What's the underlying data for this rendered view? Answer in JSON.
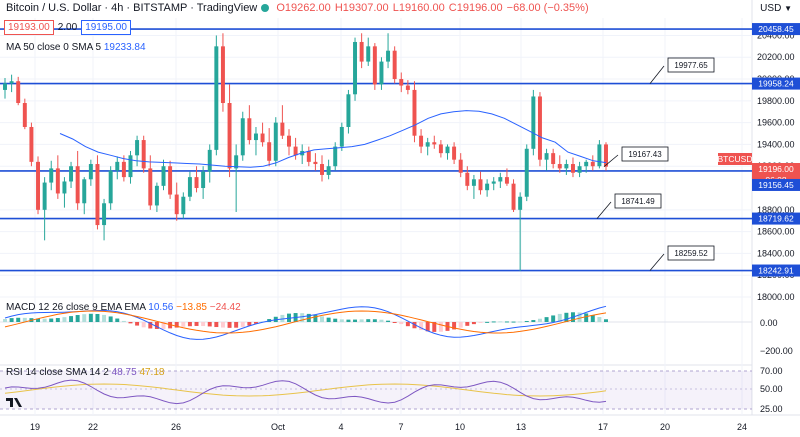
{
  "header": {
    "symbol_title": "Bitcoin / U.S. Dollar · 4h · BITSTAMP · TradingView",
    "ohlc": {
      "o": "O19262.00",
      "h": "H19307.00",
      "l": "L19160.00",
      "c": "C19196.00",
      "chg": "−68.00 (−0.35%)"
    },
    "sell_price": "19193.00",
    "spread": "2.00",
    "buy_price": "19195.00",
    "currency": "USD"
  },
  "indicators": {
    "ma": {
      "label": "MA 50 close 0 SMA 5",
      "value": "19233.84"
    },
    "macd": {
      "label": "MACD 12 26 close 9 EMA EMA",
      "v1": "10.56",
      "v2": "−13.85",
      "v3": "−24.42"
    },
    "rsi": {
      "label": "RSI 14 close SMA 14 2",
      "v1": "48.75",
      "v2": "47.18"
    }
  },
  "price_axis": [
    "20400.00",
    "20200.00",
    "20000.00",
    "19800.00",
    "19600.00",
    "19400.00",
    "19200.00",
    "18800.00",
    "18600.00",
    "18400.00",
    "18200.00",
    "18000.00"
  ],
  "price_tags": [
    {
      "value": "20458.45",
      "style": "blue"
    },
    {
      "value": "19958.24",
      "style": "blue"
    },
    {
      "value": "BTCUSD",
      "style": "red"
    },
    {
      "value": "19196.00",
      "style": "red"
    },
    {
      "value": "06:08",
      "style": "red"
    },
    {
      "value": "19156.45",
      "style": "blue"
    },
    {
      "value": "18719.62",
      "style": "blue"
    },
    {
      "value": "18242.91",
      "style": "blue"
    }
  ],
  "callouts": [
    "19977.65",
    "19167.43",
    "18741.49",
    "18259.52"
  ],
  "macd_axis": [
    "0.00",
    "−200.00"
  ],
  "rsi_axis": [
    "70.00",
    "50.00",
    "25.00"
  ],
  "time_axis": [
    "19",
    "22",
    "26",
    "Oct",
    "4",
    "7",
    "10",
    "13",
    "17",
    "20",
    "24"
  ],
  "colors": {
    "up": "#26a69a",
    "down": "#ef5350",
    "level": "#1e4fd6",
    "ma": "#2962ff",
    "signal": "#ff6d00",
    "rsi": "#7e57c2",
    "rsi_ma": "#e8c34a"
  },
  "chart_data": {
    "type": "candlestick",
    "title": "Bitcoin / U.S. Dollar · 4h · BITSTAMP",
    "levels": [
      20458.45,
      19958.24,
      19156.45,
      18719.62,
      18242.91
    ],
    "ylim": [
      18000,
      20560
    ],
    "candles": [
      [
        19900,
        20010,
        19820,
        19960
      ],
      [
        19960,
        20040,
        19880,
        19980
      ],
      [
        19980,
        20020,
        19760,
        19780
      ],
      [
        19780,
        19820,
        19540,
        19560
      ],
      [
        19560,
        19600,
        19200,
        19240
      ],
      [
        19240,
        19290,
        18760,
        18800
      ],
      [
        18800,
        19100,
        18520,
        19050
      ],
      [
        19050,
        19250,
        18980,
        19180
      ],
      [
        19180,
        19300,
        18900,
        18950
      ],
      [
        18950,
        19100,
        18820,
        19060
      ],
      [
        19060,
        19240,
        19000,
        19200
      ],
      [
        19200,
        19340,
        18800,
        18860
      ],
      [
        18860,
        19100,
        18760,
        19080
      ],
      [
        19080,
        19260,
        19020,
        19220
      ],
      [
        19220,
        19300,
        18620,
        18660
      ],
      [
        18660,
        18900,
        18520,
        18860
      ],
      [
        18860,
        19200,
        18800,
        19160
      ],
      [
        19160,
        19290,
        19080,
        19240
      ],
      [
        19240,
        19300,
        19060,
        19100
      ],
      [
        19100,
        19340,
        19040,
        19300
      ],
      [
        19300,
        19480,
        19200,
        19440
      ],
      [
        19440,
        19480,
        19140,
        19180
      ],
      [
        19180,
        19300,
        18800,
        18840
      ],
      [
        18840,
        19050,
        18780,
        19020
      ],
      [
        19020,
        19260,
        18980,
        19200
      ],
      [
        19200,
        19250,
        18900,
        18940
      ],
      [
        18940,
        19050,
        18700,
        18760
      ],
      [
        18760,
        18960,
        18720,
        18920
      ],
      [
        18920,
        19150,
        18880,
        19100
      ],
      [
        19100,
        19200,
        18960,
        19000
      ],
      [
        19000,
        19200,
        18900,
        19150
      ],
      [
        19150,
        19400,
        19050,
        19350
      ],
      [
        19350,
        20400,
        19300,
        20300
      ],
      [
        20300,
        20420,
        19700,
        19780
      ],
      [
        19780,
        19950,
        19100,
        19180
      ],
      [
        19180,
        19400,
        18780,
        19300
      ],
      [
        19300,
        19700,
        19250,
        19640
      ],
      [
        19640,
        19760,
        19400,
        19440
      ],
      [
        19440,
        19560,
        19300,
        19500
      ],
      [
        19500,
        19600,
        19380,
        19420
      ],
      [
        19420,
        19550,
        19200,
        19250
      ],
      [
        19250,
        19650,
        19200,
        19600
      ],
      [
        19600,
        19760,
        19450,
        19480
      ],
      [
        19480,
        19540,
        19300,
        19380
      ],
      [
        19380,
        19460,
        19260,
        19300
      ],
      [
        19300,
        19400,
        19220,
        19340
      ],
      [
        19340,
        19380,
        19200,
        19240
      ],
      [
        19240,
        19320,
        19160,
        19220
      ],
      [
        19220,
        19300,
        19060,
        19120
      ],
      [
        19120,
        19260,
        19080,
        19200
      ],
      [
        19200,
        19420,
        19160,
        19380
      ],
      [
        19380,
        19600,
        19340,
        19560
      ],
      [
        19560,
        19900,
        19500,
        19860
      ],
      [
        19860,
        20380,
        19800,
        20340
      ],
      [
        20340,
        20420,
        20100,
        20160
      ],
      [
        20160,
        20380,
        20120,
        20300
      ],
      [
        20300,
        20330,
        19900,
        19950
      ],
      [
        19950,
        20200,
        19900,
        20160
      ],
      [
        20160,
        20420,
        20100,
        20260
      ],
      [
        20260,
        20300,
        19960,
        20000
      ],
      [
        20000,
        20060,
        19880,
        19940
      ],
      [
        19940,
        19990,
        19860,
        19900
      ],
      [
        19900,
        19980,
        19420,
        19480
      ],
      [
        19480,
        19540,
        19320,
        19380
      ],
      [
        19380,
        19460,
        19300,
        19420
      ],
      [
        19420,
        19480,
        19360,
        19400
      ],
      [
        19400,
        19440,
        19280,
        19320
      ],
      [
        19320,
        19400,
        19260,
        19380
      ],
      [
        19380,
        19420,
        19220,
        19260
      ],
      [
        19260,
        19320,
        19100,
        19140
      ],
      [
        19140,
        19200,
        18980,
        19020
      ],
      [
        19020,
        19120,
        18900,
        19080
      ],
      [
        19080,
        19150,
        18940,
        18980
      ],
      [
        18980,
        19080,
        18920,
        19040
      ],
      [
        19040,
        19100,
        18980,
        19060
      ],
      [
        19060,
        19140,
        19000,
        19100
      ],
      [
        19100,
        19180,
        19020,
        19040
      ],
      [
        19040,
        19080,
        18780,
        18800
      ],
      [
        18800,
        18960,
        18240,
        18920
      ],
      [
        18920,
        19400,
        18880,
        19360
      ],
      [
        19360,
        19900,
        19300,
        19840
      ],
      [
        19840,
        19880,
        19200,
        19260
      ],
      [
        19260,
        19360,
        19160,
        19320
      ],
      [
        19320,
        19360,
        19180,
        19220
      ],
      [
        19220,
        19300,
        19140,
        19180
      ],
      [
        19180,
        19260,
        19120,
        19220
      ],
      [
        19220,
        19280,
        19100,
        19140
      ],
      [
        19140,
        19240,
        19100,
        19200
      ],
      [
        19200,
        19260,
        19140,
        19240
      ],
      [
        19240,
        19300,
        19160,
        19200
      ],
      [
        19200,
        19440,
        19180,
        19400
      ],
      [
        19400,
        19420,
        19160,
        19196
      ]
    ],
    "ma50": [
      19500,
      19450,
      19380,
      19330,
      19300,
      19270,
      19250,
      19240,
      19235,
      19230,
      19225,
      19220,
      19210,
      19200,
      19195,
      19190,
      19200,
      19230,
      19280,
      19320,
      19350,
      19360,
      19370,
      19380,
      19400,
      19440,
      19480,
      19530,
      19580,
      19640,
      19680,
      19700,
      19710,
      19705,
      19680,
      19640,
      19580,
      19520,
      19460,
      19420,
      19330,
      19290,
      19250,
      19233
    ]
  }
}
